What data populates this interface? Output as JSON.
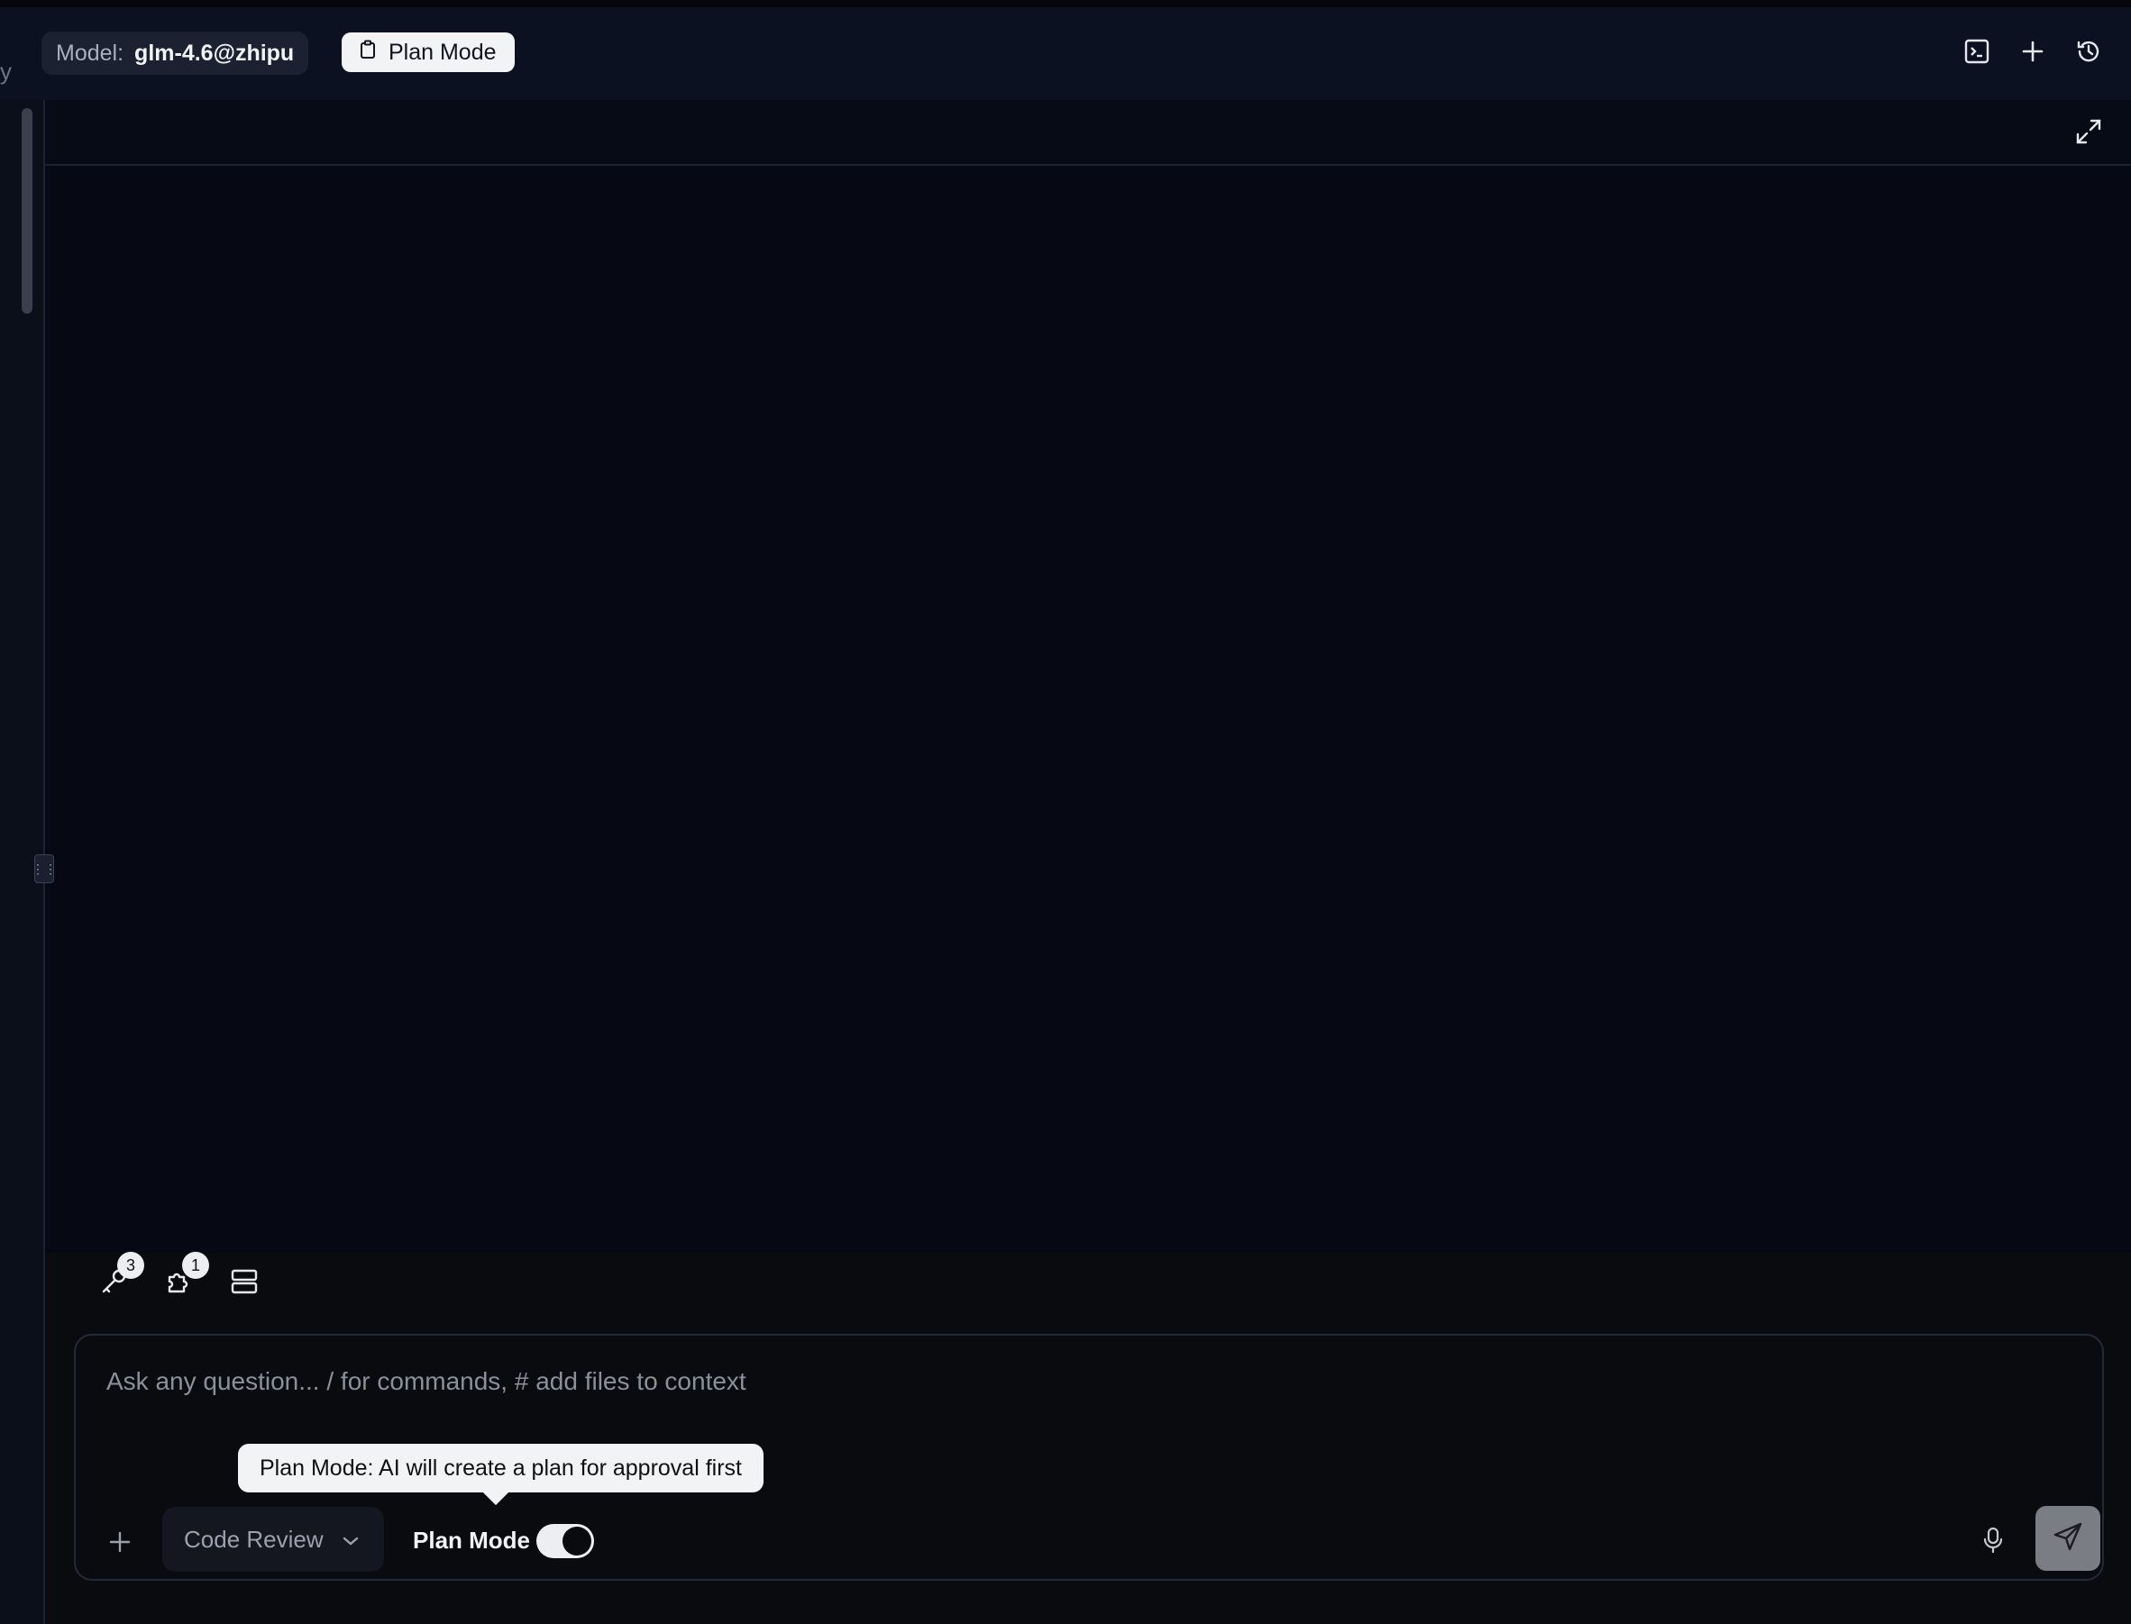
{
  "header": {
    "edge_text": "y",
    "model_label": "Model:",
    "model_value": "glm-4.6@zhipu",
    "plan_mode_button": "Plan Mode",
    "icons": [
      "terminal-icon",
      "plus-icon",
      "history-icon"
    ]
  },
  "panel": {
    "icons": [
      "expand-icon",
      "drag-handle-icon"
    ]
  },
  "toolbar": {
    "tools_badge": "3",
    "extensions_badge": "1",
    "icons": [
      "tools-icon",
      "puzzle-icon",
      "server-icon"
    ]
  },
  "composer": {
    "placeholder": "Ask any question... / for commands, # add files to context",
    "tooltip": "Plan Mode: AI will create a plan for approval first",
    "mode_select": "Code Review",
    "plan_mode_label": "Plan Mode",
    "plan_mode_on": true,
    "icons": [
      "plus-icon",
      "chevron-down-icon",
      "mic-icon",
      "send-icon"
    ]
  },
  "colors": {
    "background": "#060913",
    "header": "#0b1120",
    "chip_light": "#f2f3f5",
    "send_button": "#7a7d84"
  }
}
